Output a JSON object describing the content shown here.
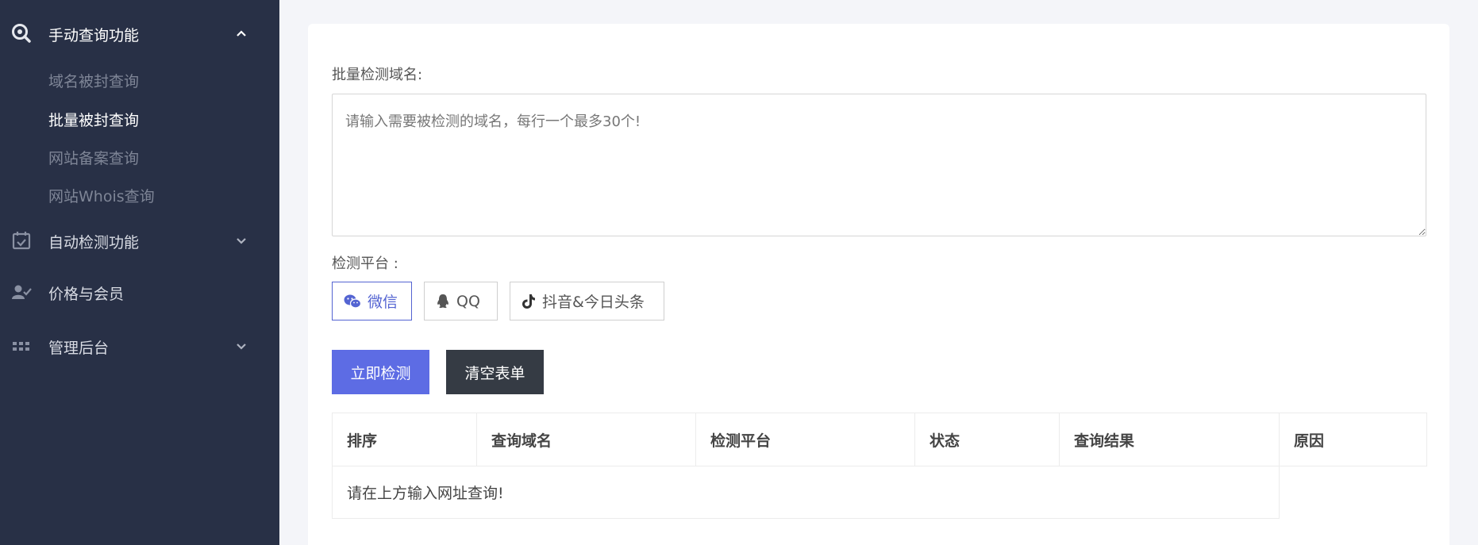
{
  "sidebar": {
    "groups": [
      {
        "label": "手动查询功能",
        "icon": "search-icon",
        "expanded": true,
        "items": [
          {
            "label": "域名被封查询",
            "active": false
          },
          {
            "label": "批量被封查询",
            "active": true
          },
          {
            "label": "网站备案查询",
            "active": false
          },
          {
            "label": "网站Whois查询",
            "active": false
          }
        ]
      },
      {
        "label": "自动检测功能",
        "icon": "calendar-check-icon",
        "expanded": false
      },
      {
        "label": "价格与会员",
        "icon": "user-check-icon"
      },
      {
        "label": "管理后台",
        "icon": "grid-icon",
        "expanded": false
      }
    ]
  },
  "form": {
    "domains_label": "批量检测域名:",
    "domains_placeholder": "请输入需要被检测的域名，每行一个最多30个!",
    "platform_label": "检测平台 :",
    "platforms": [
      {
        "label": "微信",
        "icon": "wechat-icon",
        "active": true
      },
      {
        "label": "QQ",
        "icon": "qq-icon",
        "active": false
      },
      {
        "label": "抖音&今日头条",
        "icon": "tiktok-icon",
        "active": false
      }
    ],
    "submit_label": "立即检测",
    "clear_label": "清空表单"
  },
  "table": {
    "columns": [
      "排序",
      "查询域名",
      "检测平台",
      "状态",
      "查询结果",
      "原因"
    ],
    "empty_message": "请在上方输入网址查询!"
  },
  "colors": {
    "sidebar_bg": "#283046",
    "accent": "#5d6ce4",
    "dark_button": "#353b44",
    "page_bg": "#f4f5f9"
  }
}
